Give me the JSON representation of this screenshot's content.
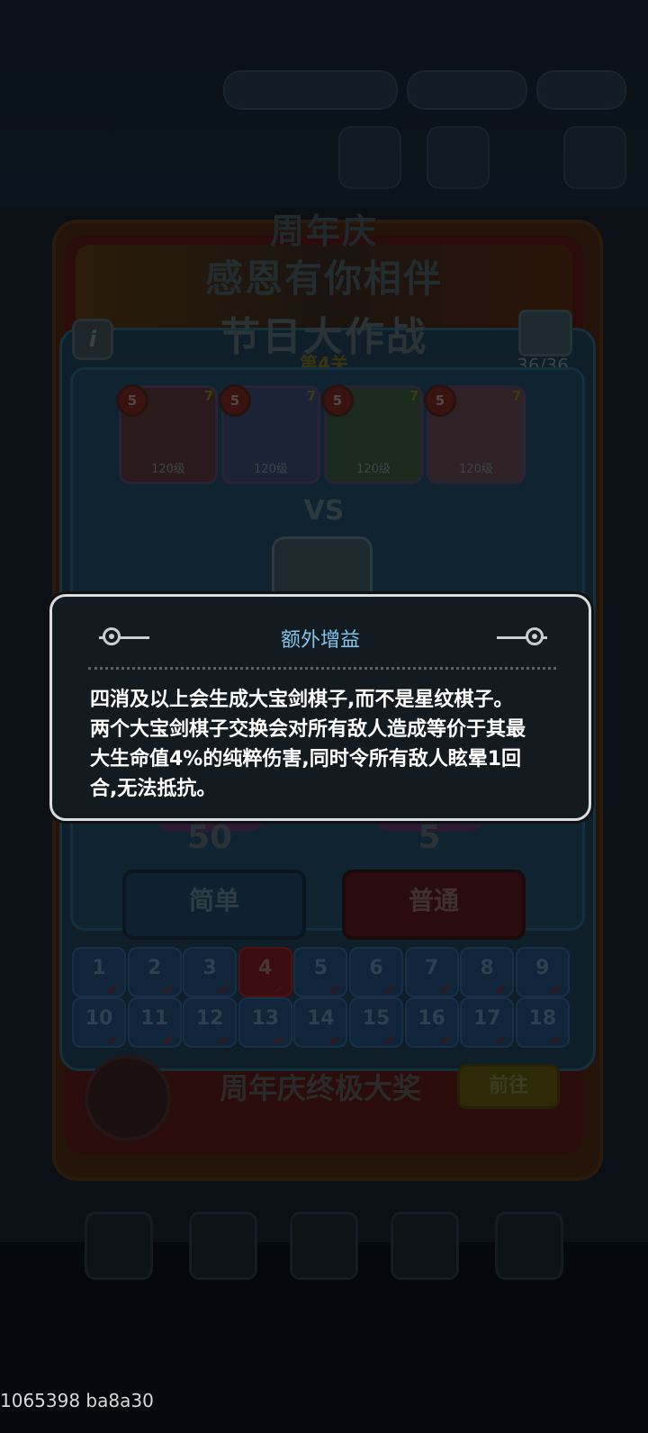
{
  "event": {
    "title_line1": "周年庆",
    "title_line2": "感恩有你相伴",
    "event_name": "节日大作战",
    "stage_label": "第4关",
    "progress": "36/36"
  },
  "heroes": [
    {
      "level": "120级",
      "stars": "7",
      "badge": "5",
      "color": "#2a1a1c"
    },
    {
      "level": "120级",
      "stars": "7",
      "badge": "5",
      "color": "#1a2436"
    },
    {
      "level": "120级",
      "stars": "7",
      "badge": "5",
      "color": "#1a2a1c"
    },
    {
      "level": "120级",
      "stars": "7",
      "badge": "5",
      "color": "#2e2226"
    }
  ],
  "vs_label": "VS",
  "rewards": [
    {
      "value": "50"
    },
    {
      "value": "5"
    }
  ],
  "difficulty": {
    "easy_label": "简单",
    "normal_label": "普通"
  },
  "stages": [
    "1",
    "2",
    "3",
    "4",
    "5",
    "6",
    "7",
    "8",
    "9",
    "10",
    "11",
    "12",
    "13",
    "14",
    "15",
    "16",
    "17",
    "18"
  ],
  "active_stage": "4",
  "grand_prize": {
    "label": "周年庆终极大奖",
    "go_label": "前往"
  },
  "tooltip": {
    "title": "额外增益",
    "lines": [
      "四消及以上会生成大宝剑棋子,而不是星纹棋子。",
      "两个大宝剑棋子交换会对所有敌人造成等价于其最",
      "大生命值4%的纯粹伤害,同时令所有敌人眩晕1回",
      "合,无法抵抗。"
    ]
  },
  "footer_id": "1065398 ba8a30"
}
